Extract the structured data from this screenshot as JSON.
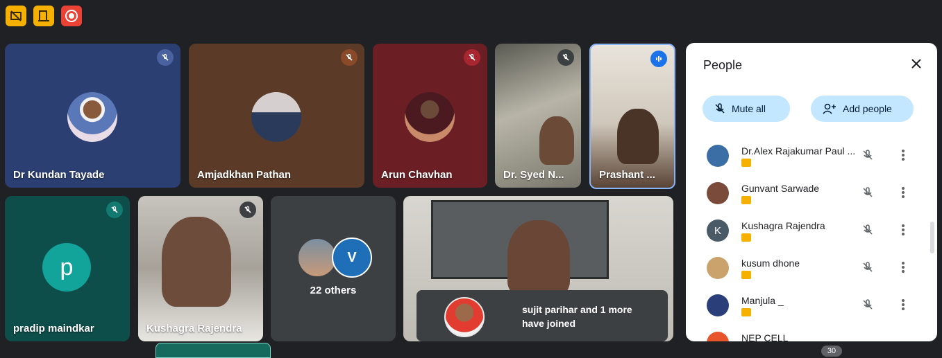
{
  "top_icons": [
    "presentation-off-icon",
    "exit-door-icon",
    "record-icon"
  ],
  "tiles": [
    {
      "name": "Dr Kundan Tayade"
    },
    {
      "name": "Amjadkhan Pathan"
    },
    {
      "name": "Arun Chavhan"
    },
    {
      "name": "Dr. Syed N..."
    },
    {
      "name": "Prashant ..."
    },
    {
      "name": "pradip maindkar",
      "initial": "p"
    },
    {
      "name": "Kushagra Rajendra"
    },
    {
      "others": "22 others"
    }
  ],
  "toast": {
    "line1": "sujit parihar and 1 more",
    "line2": "have joined"
  },
  "people_panel": {
    "title": "People",
    "mute_all": "Mute all",
    "add_people": "Add people",
    "participants": [
      {
        "name": "Dr.Alex Rajakumar Paul ...",
        "initial": "",
        "color": "#3b6ea5"
      },
      {
        "name": "Gunvant Sarwade",
        "initial": "",
        "color": "#7a4a3a"
      },
      {
        "name": "Kushagra Rajendra",
        "initial": "K",
        "color": "#4a5a66"
      },
      {
        "name": "kusum dhone",
        "initial": "",
        "color": "#c9a36b"
      },
      {
        "name": "Manjula _",
        "initial": "",
        "color": "#2a3f7a"
      },
      {
        "name": "NEP CELL",
        "initial": "",
        "color": "#e8542b"
      }
    ]
  },
  "participant_count": "30",
  "colors": {
    "accent": "#c2e7ff",
    "meet_bg": "#202124",
    "badge": "#f6b100"
  }
}
